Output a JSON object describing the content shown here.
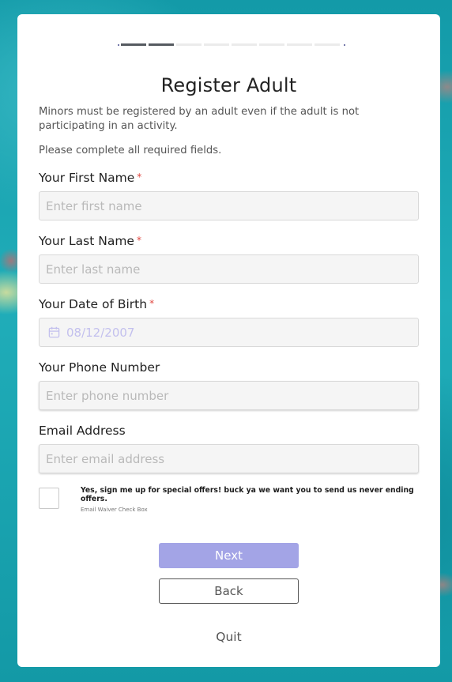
{
  "progress": {
    "total_steps": 8,
    "completed_steps": 2
  },
  "title": "Register Adult",
  "intro_text": "Minors must be registered by an adult even if the adult is not participating in an activity.",
  "required_note": "Please complete all required fields.",
  "fields": {
    "first_name": {
      "label": "Your First Name",
      "required_mark": "*",
      "placeholder": "Enter first name",
      "value": ""
    },
    "last_name": {
      "label": "Your Last Name",
      "required_mark": "*",
      "placeholder": "Enter last name",
      "value": ""
    },
    "dob": {
      "label": "Your Date of Birth",
      "required_mark": "*",
      "value": "08/12/2007",
      "icon": "calendar-icon"
    },
    "phone": {
      "label": "Your Phone Number",
      "placeholder": "Enter phone number",
      "value": ""
    },
    "email": {
      "label": "Email Address",
      "placeholder": "Enter email address",
      "value": ""
    }
  },
  "offers_checkbox": {
    "checked": false,
    "label": "Yes, sign me up for special offers! buck ya we want you to send us never ending offers.",
    "caption": "Email Waiver Check Box"
  },
  "buttons": {
    "next": "Next",
    "back": "Back",
    "quit": "Quit"
  },
  "colors": {
    "accent": "#a3a4e6",
    "required": "#e0463f",
    "progress_done": "#555a60",
    "progress_todo": "#ebebeb"
  }
}
